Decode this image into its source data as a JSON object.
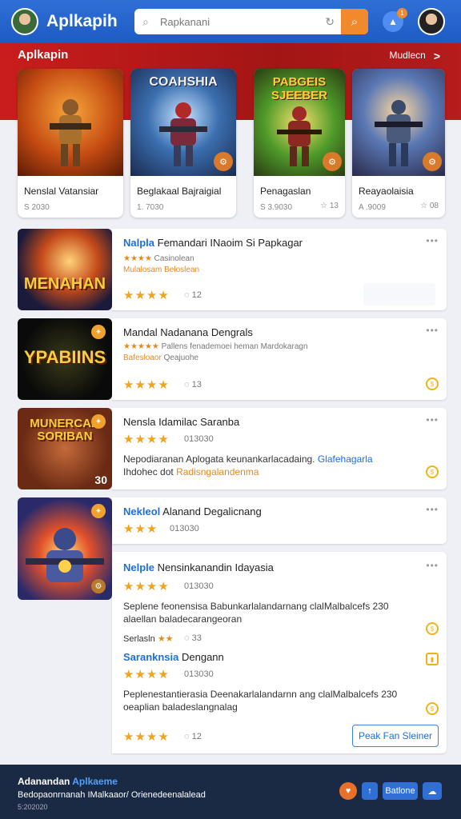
{
  "header": {
    "brand": "Aplkapih",
    "search_placeholder": "Rapkanani",
    "notification_count": "1"
  },
  "banner": {
    "title": "Aplkapin",
    "more_label": "Mudlecn"
  },
  "featured": [
    {
      "art_text": "",
      "title": "Nenslal Vatansiar",
      "meta": "S 2030",
      "rating": ""
    },
    {
      "art_text": "COAHSHIA",
      "title": "Beglakaal Bajraigial",
      "meta": "1. 7030",
      "rating": ""
    },
    {
      "art_text": "PABGEIS SJEEBER",
      "title": "Penagaslan",
      "meta": "S 3.9030",
      "rating": "☆ 13"
    },
    {
      "art_text": "",
      "title": "Reayaolaisia",
      "meta": "A .9009",
      "rating": "☆ 08"
    }
  ],
  "list": [
    {
      "thumb_text": "MENAHAN",
      "title_hl": "Nalpla",
      "title": "Femandari INaoim Si Papkagar",
      "stars_small": "★★★★",
      "sub1": "Casinolean",
      "sub2_or": "Mulalosam",
      "sub2": "Beloslean",
      "stars": "★★★★",
      "count": "12"
    },
    {
      "thumb_text": "YPABIINS",
      "title": "Mandal Nadanana Dengrals",
      "stars_small": "★★★★★",
      "sub1": "Pallens fenademoei heman Mardokaragn",
      "sub2_or": "Bafesloaor",
      "sub2": "Qeajuohe",
      "stars": "★★★★",
      "count": "13"
    },
    {
      "thumb_text": "MUNERCAN SORIBAN",
      "title": "Nensla Idamilac Saranba",
      "stars": "★★★★",
      "count": "013030",
      "desc1": "Nepodiaranan Aplogata keunankarlacadaing.",
      "desc1_bl": "Glafehagarla",
      "desc2": "Ihdohec dot",
      "desc2_or": "Radisngalandenma",
      "badge": "30"
    },
    {
      "title_hl": "Nekleol",
      "title": "Alanand Degalicnang",
      "stars": "★★★",
      "count": "013030"
    },
    {
      "title_hl": "Nelple",
      "title": "Nensinkanandin Idayasia",
      "stars": "★★★★",
      "count": "013030",
      "desc1": "Seplene feonensisa Babunkarlalandarnang clalMalbalcefs 230",
      "desc2": "alaellan baladecarangeoran",
      "small_label": "Serlasln",
      "small_stars": "★★",
      "small_count": "33",
      "sub_title": "Saranknsia",
      "sub_title_rest": "Dengann",
      "stars2": "★★★★",
      "count2": "013030",
      "desc3": "Peplenestantierasia Deenakarlalandarnn ang clalMalbalcefs 230",
      "desc4": "oeaplian baladeslangnalag",
      "stars3": "★★★★",
      "count3": "12",
      "follow_label": "Peak Fan Sleiner"
    }
  ],
  "footer": {
    "title": "Adanandan",
    "title_bl": "Aplkaeme",
    "subtitle": "Bedopaonrnanah IMalkaaor/ Orienedeenalalead",
    "count": "5:202020",
    "btn_label": "Batlone"
  }
}
